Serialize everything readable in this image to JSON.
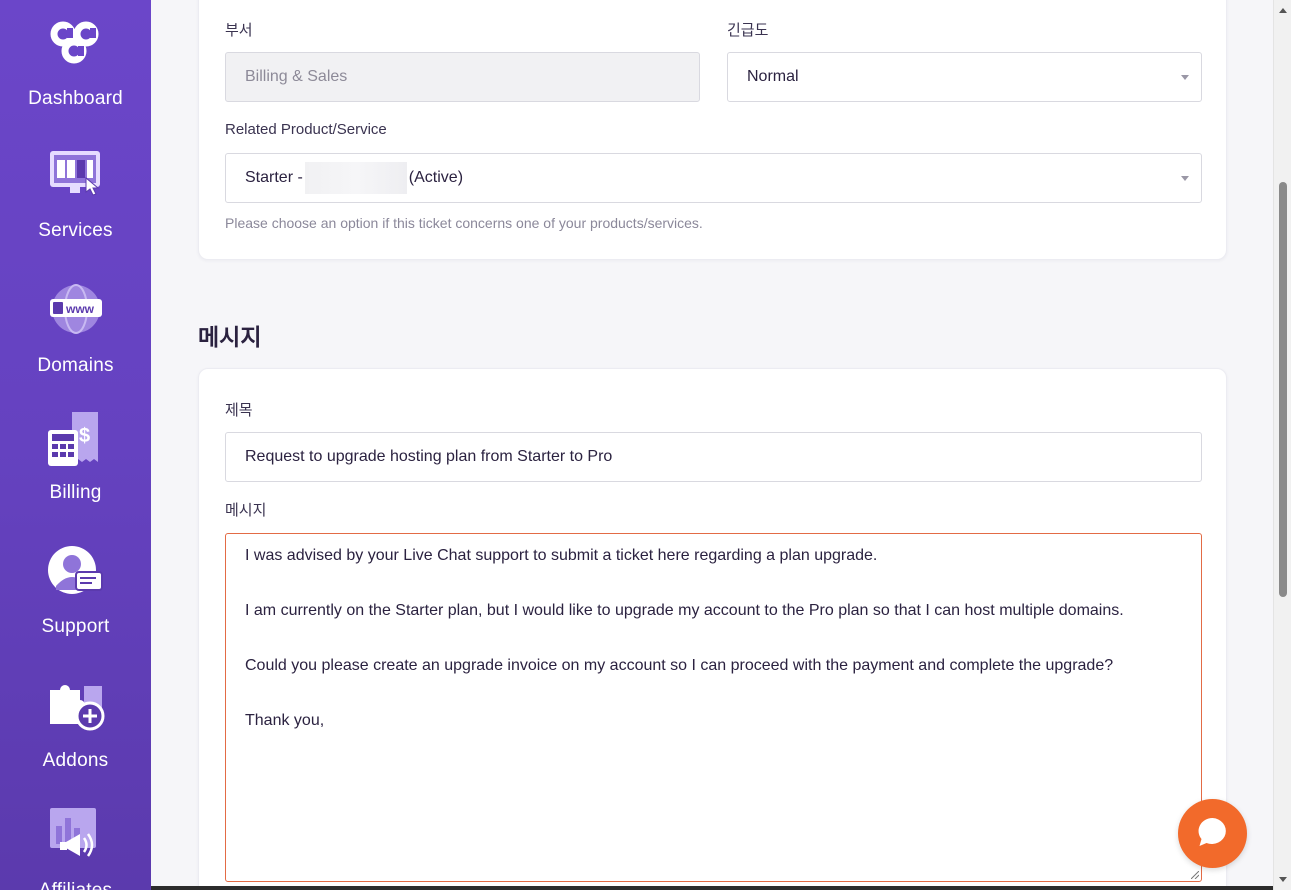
{
  "sidebar": {
    "items": [
      {
        "label": "Dashboard",
        "icon": "ccc-logo-icon"
      },
      {
        "label": "Services",
        "icon": "services-monitor-icon"
      },
      {
        "label": "Domains",
        "icon": "www-globe-icon"
      },
      {
        "label": "Billing",
        "icon": "billing-calculator-icon"
      },
      {
        "label": "Support",
        "icon": "support-agent-icon"
      },
      {
        "label": "Addons",
        "icon": "addons-puzzle-icon"
      },
      {
        "label": "Affiliates",
        "icon": "affiliates-megaphone-icon"
      }
    ]
  },
  "ticket": {
    "department_label": "부서",
    "department_value": "Billing & Sales",
    "priority_label": "긴급도",
    "priority_value": "Normal",
    "related_label": "Related Product/Service",
    "related_prefix": "Starter -",
    "related_suffix": "(Active)",
    "related_help": "Please choose an option if this ticket concerns one of your products/services."
  },
  "message_section": {
    "title": "메시지",
    "subject_label": "제목",
    "subject_value": "Request to upgrade hosting plan from Starter to Pro",
    "message_label": "메시지",
    "message_lines": [
      "I was advised by your Live Chat support to submit a ticket here regarding a plan upgrade.",
      "I am currently on the Starter plan, but I would like to upgrade my account to the Pro plan so that I can host multiple domains.",
      "Could you please create an upgrade invoice on my account so I can proceed with the payment and complete the upgrade?",
      "Thank you,"
    ]
  },
  "colors": {
    "sidebar": "#6542c0",
    "accent_orange": "#f26a2b",
    "textarea_focus_border": "#e36b45"
  }
}
